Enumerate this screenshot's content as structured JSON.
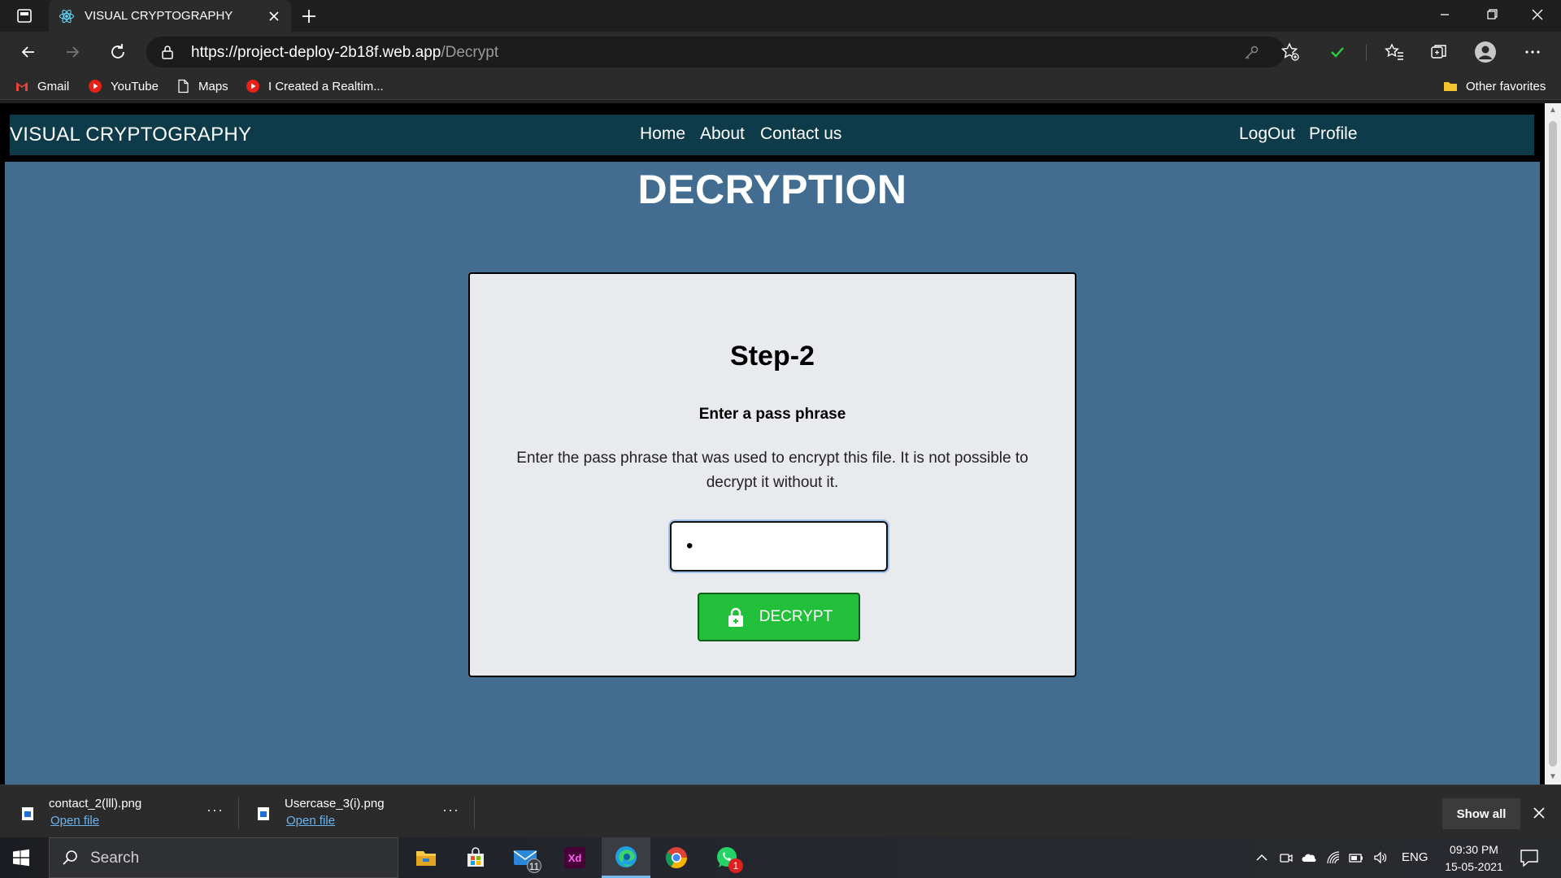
{
  "browser": {
    "tab_title": "VISUAL CRYPTOGRAPHY",
    "url_host": "https://project-deploy-2b18f.web.app",
    "url_path": "/Decrypt",
    "bookmarks": [
      {
        "label": "Gmail",
        "icon": "gmail-icon"
      },
      {
        "label": "YouTube",
        "icon": "youtube-icon"
      },
      {
        "label": "Maps",
        "icon": "page-icon"
      },
      {
        "label": "I Created a Realtim...",
        "icon": "youtube-icon"
      }
    ],
    "other_favorites": "Other favorites"
  },
  "site": {
    "brand": "VISUAL CRYPTOGRAPHY",
    "nav": [
      "Home",
      "About",
      "Contact us"
    ],
    "right_nav": [
      "LogOut",
      "Profile"
    ],
    "nav_bg": "#0e3b4a",
    "page_bg": "#426d90"
  },
  "page": {
    "title": "DECRYPTION",
    "step_title": "Step-2",
    "subtitle": "Enter a pass phrase",
    "description": "Enter the pass phrase that was used to encrypt this file. It is not possible to decrypt it without it.",
    "passphrase_value": "•",
    "button_label": "DECRYPT",
    "button_color": "#22c03a"
  },
  "downloads": {
    "items": [
      {
        "name": "contact_2(lll).png",
        "action": "Open file"
      },
      {
        "name": "Usercase_3(i).png",
        "action": "Open file"
      }
    ],
    "show_all": "Show all"
  },
  "taskbar": {
    "search_placeholder": "Search",
    "mail_badge": "11",
    "whatsapp_badge": "1",
    "language": "ENG",
    "time": "09:30 PM",
    "date": "15-05-2021"
  }
}
